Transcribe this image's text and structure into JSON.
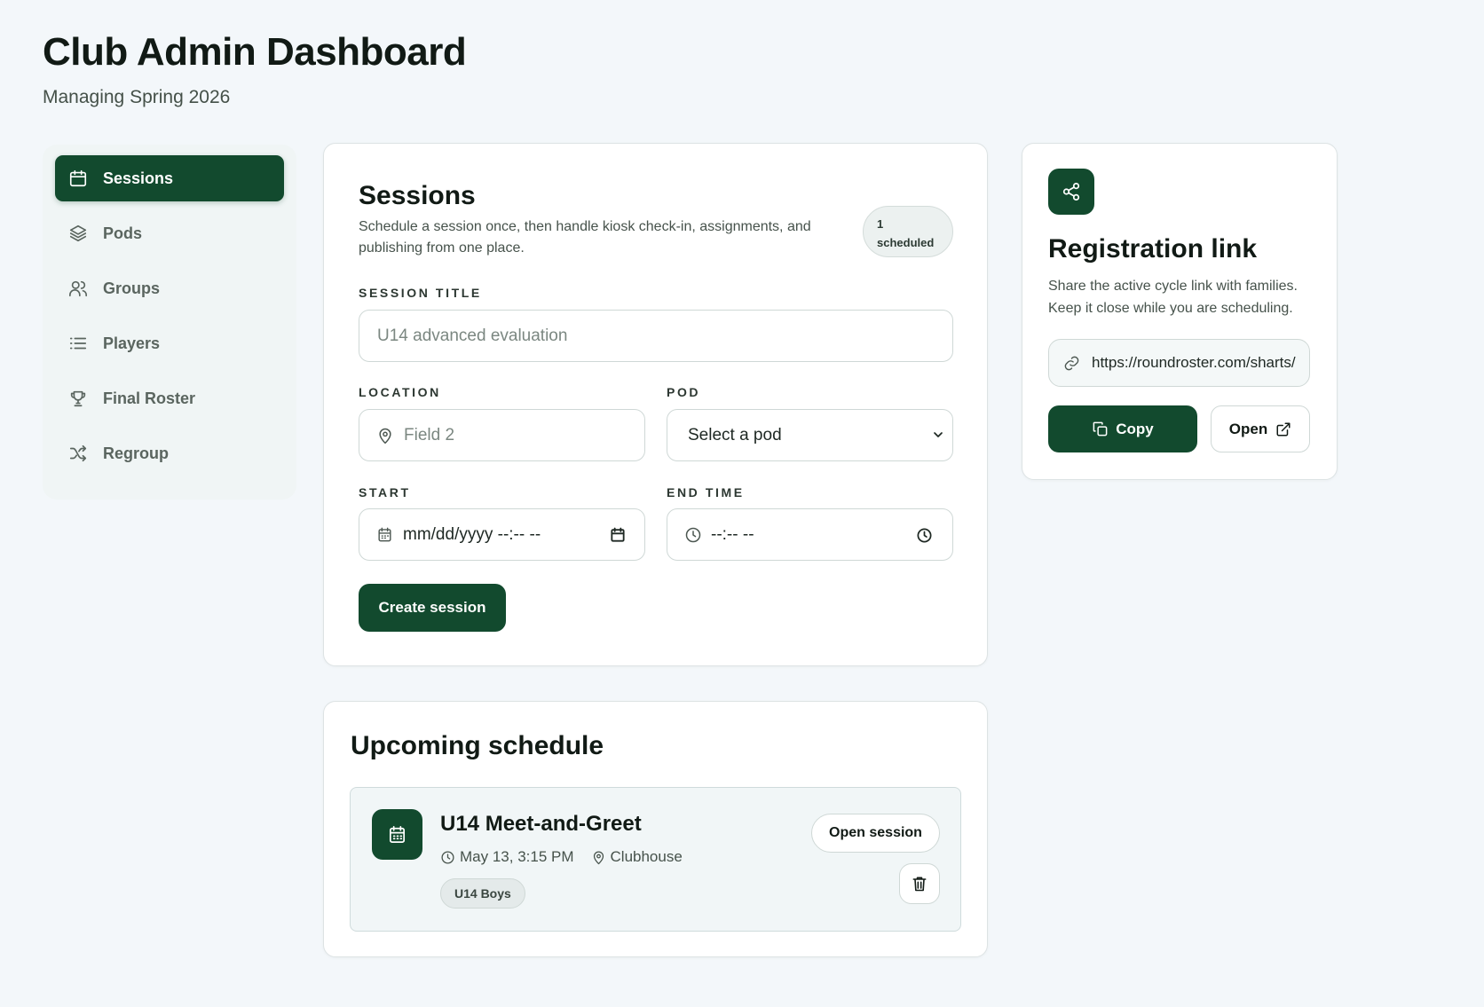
{
  "header": {
    "title": "Club Admin Dashboard",
    "subtitle": "Managing Spring 2026"
  },
  "sidebar": {
    "items": [
      {
        "label": "Sessions",
        "icon": "calendar-icon",
        "active": true
      },
      {
        "label": "Pods",
        "icon": "layers-icon",
        "active": false
      },
      {
        "label": "Groups",
        "icon": "users-icon",
        "active": false
      },
      {
        "label": "Players",
        "icon": "list-icon",
        "active": false
      },
      {
        "label": "Final Roster",
        "icon": "trophy-icon",
        "active": false
      },
      {
        "label": "Regroup",
        "icon": "shuffle-icon",
        "active": false
      }
    ]
  },
  "sessions": {
    "title": "Sessions",
    "description": "Schedule a session once, then handle kiosk check-in, assignments, and publishing from one place.",
    "badge_count": "1",
    "badge_label": "scheduled",
    "form": {
      "title_label": "SESSION TITLE",
      "title_placeholder": "U14 advanced evaluation",
      "location_label": "LOCATION",
      "location_placeholder": "Field 2",
      "pod_label": "POD",
      "pod_value": "Select a pod",
      "start_label": "START",
      "start_placeholder": "mm/dd/yyyy --:-- --",
      "end_label": "END TIME",
      "end_placeholder": "--:-- --",
      "submit_label": "Create session"
    }
  },
  "schedule": {
    "title": "Upcoming schedule",
    "items": [
      {
        "name": "U14 Meet-and-Greet",
        "datetime": "May 13, 3:15 PM",
        "location": "Clubhouse",
        "tag": "U14 Boys",
        "open_label": "Open session"
      }
    ]
  },
  "registration": {
    "title": "Registration link",
    "description": "Share the active cycle link with families. Keep it close while you are scheduling.",
    "url": "https://roundroster.com/sharts/",
    "copy_label": "Copy",
    "open_label": "Open"
  },
  "colors": {
    "brand": "#124a2e",
    "background": "#f3f7fa"
  }
}
